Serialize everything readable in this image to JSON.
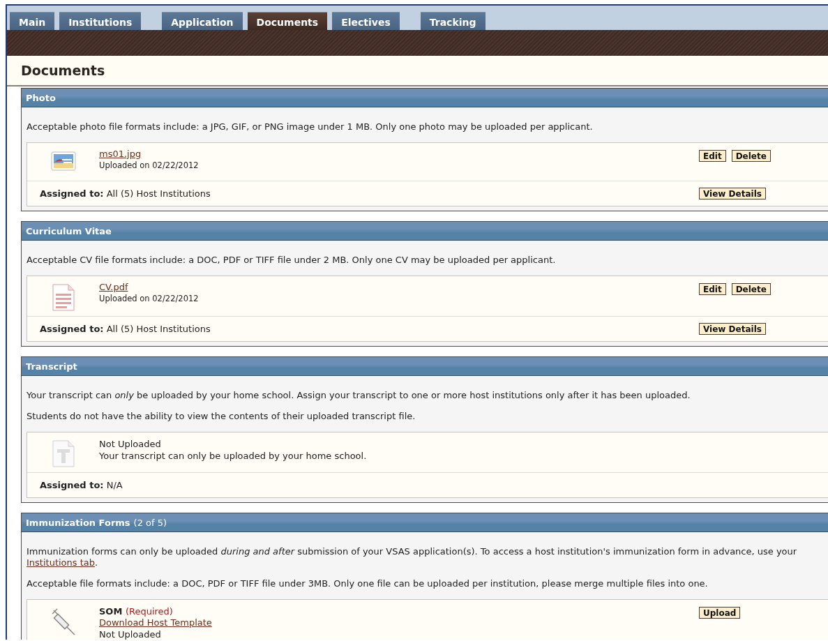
{
  "tabs": [
    {
      "label": "Main",
      "selected": false
    },
    {
      "label": "Institutions",
      "selected": false
    },
    {
      "label": "Application",
      "selected": false
    },
    {
      "label": "Documents",
      "selected": true
    },
    {
      "label": "Electives",
      "selected": false
    },
    {
      "label": "Tracking",
      "selected": false
    }
  ],
  "page_title": "Documents",
  "sections": [
    {
      "title": "Photo",
      "paragraphs": [
        [
          {
            "kind": "text",
            "text": "Acceptable photo file formats include: a JPG, GIF, or PNG image under 1 MB. Only one photo may be uploaded per applicant."
          }
        ]
      ],
      "documents": [
        {
          "kind": "image",
          "lines": [
            {
              "kind": "link",
              "text": "ms01.jpg"
            },
            {
              "kind": "small",
              "text": "Uploaded on 02/22/2012"
            }
          ],
          "actions": [
            "Edit",
            "Delete"
          ],
          "assigned_label": "Assigned to:",
          "assigned_value": "All (5) Host Institutions",
          "detail_button": "View Details"
        }
      ]
    },
    {
      "title": "Curriculum Vitae",
      "paragraphs": [
        [
          {
            "kind": "text",
            "text": "Acceptable CV file formats include: a DOC, PDF or TIFF file under 2 MB. Only one CV may be uploaded per applicant."
          }
        ]
      ],
      "documents": [
        {
          "kind": "pdf",
          "lines": [
            {
              "kind": "link",
              "text": "CV.pdf"
            },
            {
              "kind": "small",
              "text": "Uploaded on 02/22/2012"
            }
          ],
          "actions": [
            "Edit",
            "Delete"
          ],
          "assigned_label": "Assigned to:",
          "assigned_value": "All (5) Host Institutions",
          "detail_button": "View Details"
        }
      ]
    },
    {
      "title": "Transcript",
      "paragraphs": [
        [
          {
            "kind": "text",
            "text": "Your transcript can *only* be uploaded by your home school. Assign your transcript to one or more host institutions only after it has been uploaded."
          }
        ],
        [
          {
            "kind": "text",
            "text": "Students do not have the ability to view the contents of their uploaded transcript file."
          }
        ]
      ],
      "documents": [
        {
          "kind": "blank",
          "lines": [
            {
              "kind": "plain",
              "text": "Not Uploaded"
            },
            {
              "kind": "plain",
              "text": "Your transcript can only be uploaded by your home school."
            }
          ],
          "assigned_label": "Assigned to:",
          "assigned_value": "N/A"
        }
      ]
    },
    {
      "title": "Immunization Forms",
      "count": "(2 of 5)",
      "paragraphs": [
        [
          {
            "kind": "text",
            "text": "Immunization forms can only be uploaded *during and after* submission of your VSAS application(s). To access a host institution's immunization form in advance, use your "
          },
          {
            "kind": "link",
            "text": "Institutions tab"
          },
          {
            "kind": "text",
            "text": "."
          }
        ],
        [
          {
            "kind": "text",
            "text": "Acceptable file formats include: a DOC, PDF or TIFF file under 3MB. Only one file can be uploaded per institution, please merge multiple files into one."
          }
        ]
      ],
      "documents": [
        {
          "kind": "syringe",
          "lines": [
            {
              "kind": "heading",
              "text": "SOM",
              "note": "(Required)"
            },
            {
              "kind": "link",
              "text": "Download Host Template"
            },
            {
              "kind": "plain",
              "text": "Not Uploaded"
            }
          ],
          "actions": [
            "Upload"
          ]
        }
      ]
    }
  ]
}
